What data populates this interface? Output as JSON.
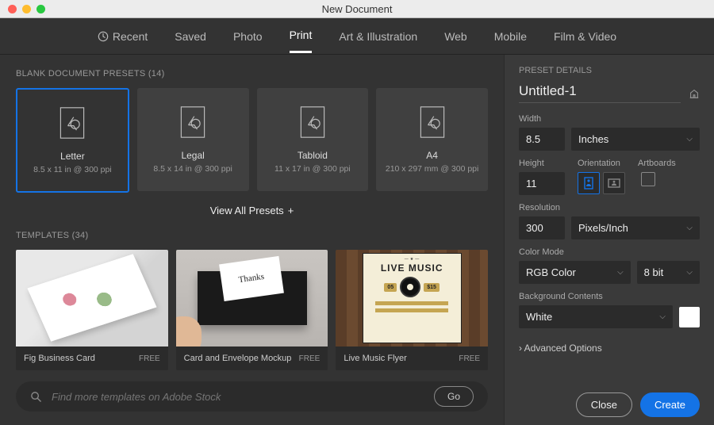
{
  "window": {
    "title": "New Document"
  },
  "tabs": {
    "recent": "Recent",
    "saved": "Saved",
    "photo": "Photo",
    "print": "Print",
    "art": "Art & Illustration",
    "web": "Web",
    "mobile": "Mobile",
    "film": "Film & Video",
    "active": "print"
  },
  "presets_section": {
    "label": "BLANK DOCUMENT PRESETS",
    "count": "(14)"
  },
  "presets": [
    {
      "name": "Letter",
      "dim": "8.5 x 11 in @ 300 ppi",
      "selected": true
    },
    {
      "name": "Legal",
      "dim": "8.5 x 14 in @ 300 ppi",
      "selected": false
    },
    {
      "name": "Tabloid",
      "dim": "11 x 17 in @ 300 ppi",
      "selected": false
    },
    {
      "name": "A4",
      "dim": "210 x 297 mm @ 300 ppi",
      "selected": false
    }
  ],
  "view_all": "View All Presets",
  "templates_section": {
    "label": "TEMPLATES",
    "count": "(34)"
  },
  "templates": [
    {
      "name": "Fig Business Card",
      "price": "FREE"
    },
    {
      "name": "Card and Envelope Mockup",
      "price": "FREE"
    },
    {
      "name": "Live Music Flyer",
      "price": "FREE"
    }
  ],
  "search": {
    "placeholder": "Find more templates on Adobe Stock",
    "go": "Go"
  },
  "details": {
    "header": "PRESET DETAILS",
    "name": "Untitled-1",
    "width_label": "Width",
    "width": "8.5",
    "units": "Inches",
    "height_label": "Height",
    "height": "11",
    "orientation_label": "Orientation",
    "orientation": "portrait",
    "artboards_label": "Artboards",
    "artboards_checked": false,
    "resolution_label": "Resolution",
    "resolution": "300",
    "resolution_units": "Pixels/Inch",
    "color_mode_label": "Color Mode",
    "color_mode": "RGB Color",
    "bit_depth": "8 bit",
    "bg_label": "Background Contents",
    "bg": "White",
    "bg_color": "#ffffff",
    "advanced": "Advanced Options"
  },
  "footer": {
    "close": "Close",
    "create": "Create"
  }
}
